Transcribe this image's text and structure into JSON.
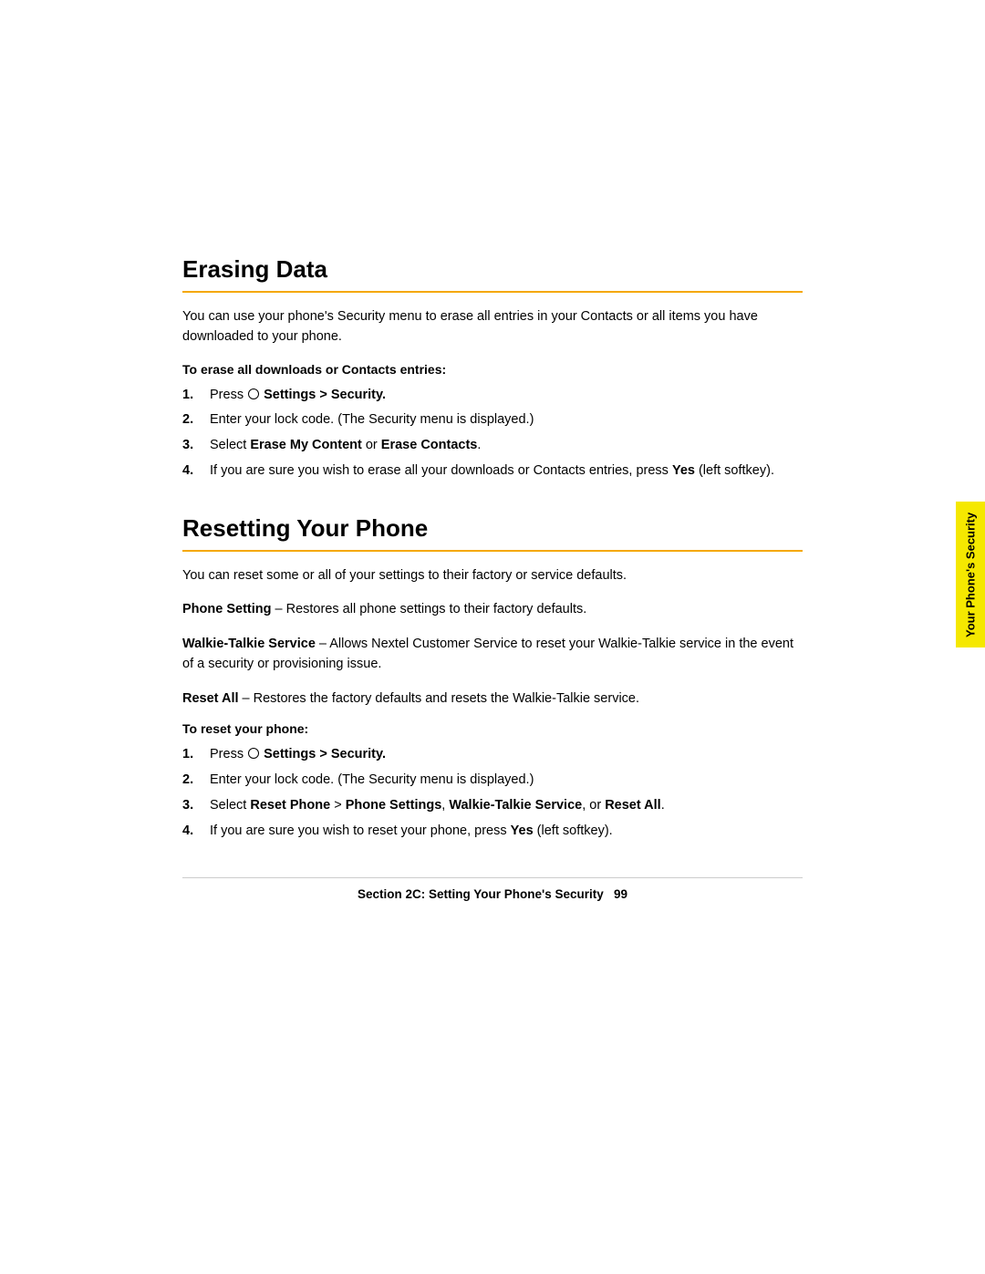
{
  "page": {
    "background": "#ffffff"
  },
  "erasing_data": {
    "title": "Erasing Data",
    "intro": "You can use your phone's Security menu to erase all entries in your Contacts or all items you have downloaded to your phone.",
    "instruction_heading": "To erase all downloads or Contacts entries:",
    "steps": [
      {
        "num": "1.",
        "text_before": "Press ",
        "circle": true,
        "text_bold": " Settings > Security.",
        "text_after": ""
      },
      {
        "num": "2.",
        "text_plain": "Enter your lock code. (The Security menu is displayed.)"
      },
      {
        "num": "3.",
        "text_before": "Select ",
        "text_bold1": "Erase My Content",
        "text_mid": " or ",
        "text_bold2": "Erase Contacts",
        "text_after": "."
      },
      {
        "num": "4.",
        "text_before": "If you are sure you wish to erase all your downloads or Contacts entries, press ",
        "text_bold": "Yes",
        "text_after": " (left softkey)."
      }
    ]
  },
  "resetting_your_phone": {
    "title": "Resetting Your Phone",
    "intro": "You can reset some or all of your settings to their factory or service defaults.",
    "definitions": [
      {
        "term": "Phone Setting",
        "separator": " – ",
        "description": "Restores all phone settings to their factory defaults."
      },
      {
        "term": "Walkie-Talkie Service",
        "separator": " – ",
        "description": "Allows Nextel Customer Service to reset your Walkie-Talkie service in the event of a security or provisioning issue."
      },
      {
        "term": "Reset All",
        "separator": " – ",
        "description": "Restores the factory defaults and resets the Walkie-Talkie service."
      }
    ],
    "to_reset_heading": "To reset your phone:",
    "steps": [
      {
        "num": "1.",
        "text_before": "Press ",
        "circle": true,
        "text_bold": " Settings > Security.",
        "text_after": ""
      },
      {
        "num": "2.",
        "text_plain": "Enter your lock code. (The Security menu is displayed.)"
      },
      {
        "num": "3.",
        "text_before": "Select ",
        "text_bold1": "Reset Phone",
        "text_mid": " > ",
        "text_bold2": "Phone Settings",
        "text_mid2": ", ",
        "text_bold3": "Walkie-Talkie Service",
        "text_mid3": ", or ",
        "text_bold4": "Reset All",
        "text_after": "."
      },
      {
        "num": "4.",
        "text_before": "If you are sure you wish to reset your phone, press ",
        "text_bold": "Yes",
        "text_after": " (left softkey)."
      }
    ]
  },
  "side_tab": {
    "label": "Your Phone's Security"
  },
  "footer": {
    "text": "Section 2C: Setting Your Phone's Security",
    "page_num": "99"
  }
}
